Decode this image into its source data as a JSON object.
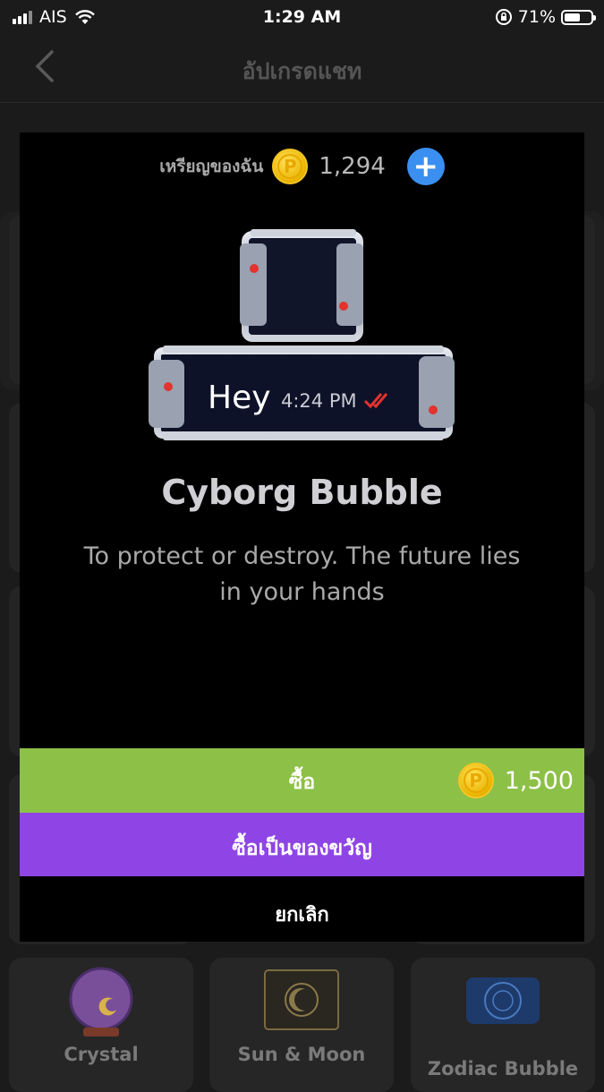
{
  "status_bar": {
    "carrier": "AIS",
    "time": "1:29 AM",
    "battery": "71%",
    "battery_level": 0.71,
    "icons": [
      "signal-icon",
      "wifi-icon",
      "orientation-lock-icon",
      "battery-icon"
    ]
  },
  "nav": {
    "title": "อัปเกรดแชท",
    "back_icon": "chevron-left-icon"
  },
  "modal": {
    "coins_label": "เหรียญของฉัน",
    "coin_symbol": "P",
    "coins_value": "1,294",
    "add_symbol": "+",
    "preview": {
      "message": "Hey",
      "timestamp": "4:24 PM"
    },
    "title": "Cyborg Bubble",
    "description": "To protect or destroy. The future lies in your hands",
    "buy": {
      "label": "ซื้อ",
      "price": "1,500"
    },
    "gift_label": "ซื้อเป็นของขวัญ",
    "cancel_label": "ยกเลิก"
  },
  "background_shop": {
    "items": [
      {
        "label": "Crystal"
      },
      {
        "label": "Sun & Moon"
      },
      {
        "label": "Zodiac Bubble"
      }
    ]
  },
  "colors": {
    "buy_green": "#8dc047",
    "gift_purple": "#8f45e5",
    "add_blue": "#3b8ff0",
    "coin_gold": "#f3c624",
    "checkmark_red": "#e2332f"
  }
}
